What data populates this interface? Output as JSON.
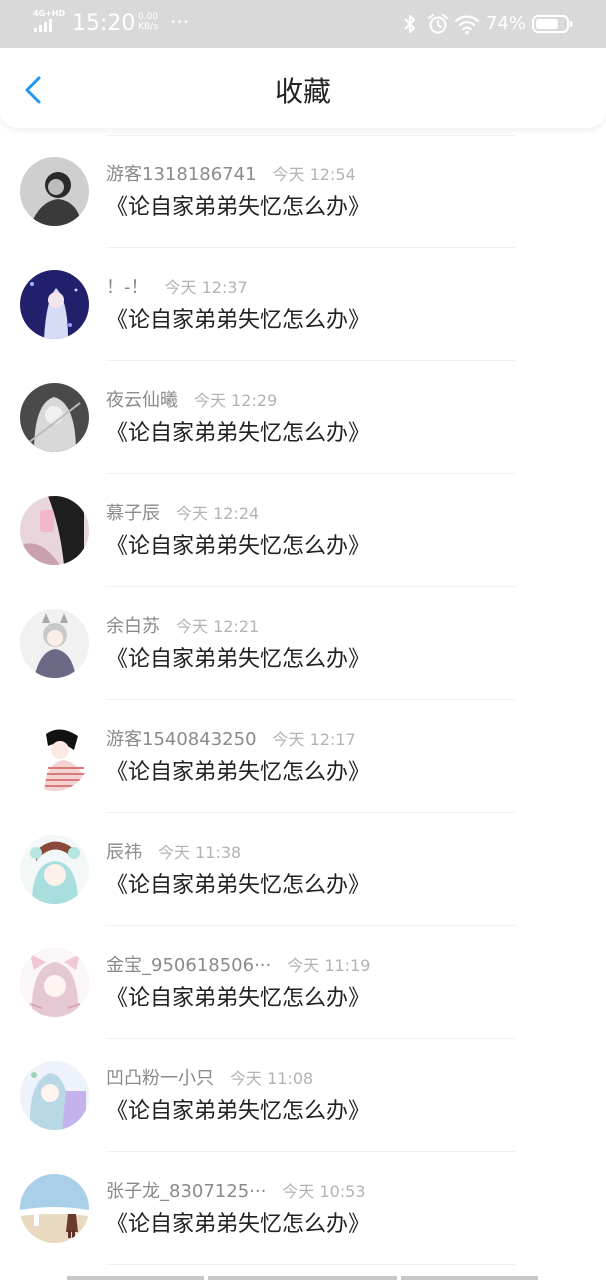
{
  "status_bar": {
    "network": "4G+HD",
    "time": "15:20",
    "speed_value": "0.00",
    "speed_unit": "KB/s",
    "more": "···",
    "battery": "74%",
    "icons": [
      "signal-icon",
      "bluetooth-icon",
      "alarm-icon",
      "wifi-icon",
      "battery-icon"
    ]
  },
  "header": {
    "title": "收藏",
    "back_icon": "chevron-left-icon",
    "accent_color": "#2196f3"
  },
  "favorites": [
    {
      "user": "游客1318186741",
      "time": "今天 12:54",
      "title": "《论自家弟弟失忆怎么办》"
    },
    {
      "user": "！-！",
      "time": "今天 12:37",
      "title": "《论自家弟弟失忆怎么办》"
    },
    {
      "user": "夜云仙曦",
      "time": "今天 12:29",
      "title": "《论自家弟弟失忆怎么办》"
    },
    {
      "user": "慕子辰",
      "time": "今天 12:24",
      "title": "《论自家弟弟失忆怎么办》"
    },
    {
      "user": "余白苏",
      "time": "今天 12:21",
      "title": "《论自家弟弟失忆怎么办》"
    },
    {
      "user": "游客1540843250",
      "time": "今天 12:17",
      "title": "《论自家弟弟失忆怎么办》"
    },
    {
      "user": "辰祎",
      "time": "今天 11:38",
      "title": "《论自家弟弟失忆怎么办》"
    },
    {
      "user": "金宝_950618506···",
      "time": "今天 11:19",
      "title": "《论自家弟弟失忆怎么办》"
    },
    {
      "user": "凹凸粉一小只",
      "time": "今天 11:08",
      "title": "《论自家弟弟失忆怎么办》"
    },
    {
      "user": "张子龙_8307125···",
      "time": "今天 10:53",
      "title": "《论自家弟弟失忆怎么办》"
    }
  ]
}
